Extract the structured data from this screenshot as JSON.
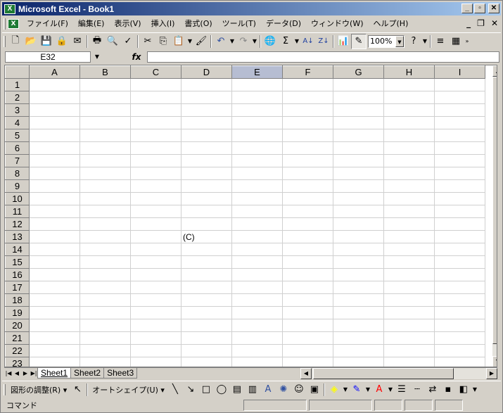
{
  "window": {
    "title": "Microsoft Excel - Book1",
    "app_icon": "X"
  },
  "menu": {
    "items": [
      "ファイル(F)",
      "編集(E)",
      "表示(V)",
      "挿入(I)",
      "書式(O)",
      "ツール(T)",
      "データ(D)",
      "ウィンドウ(W)",
      "ヘルプ(H)"
    ]
  },
  "toolbar": {
    "zoom": "100%"
  },
  "formula_bar": {
    "name_box": "E32",
    "fx": "fx",
    "content": ""
  },
  "grid": {
    "columns": [
      "A",
      "B",
      "C",
      "D",
      "E",
      "F",
      "G",
      "H",
      "I"
    ],
    "selected_column": "E",
    "rows": [
      "1",
      "2",
      "3",
      "4",
      "5",
      "6",
      "7",
      "8",
      "9",
      "10",
      "11",
      "12",
      "13",
      "14",
      "15",
      "16",
      "17",
      "18",
      "19",
      "20",
      "21",
      "22",
      "23"
    ],
    "cells": {
      "D13": "(C)"
    }
  },
  "sheets": {
    "tabs": [
      "Sheet1",
      "Sheet2",
      "Sheet3"
    ],
    "active": "Sheet1"
  },
  "drawing_toolbar": {
    "draw_label": "図形の調整(R)",
    "autoshape_label": "オートシェイプ(U)"
  },
  "status": {
    "text": "コマンド"
  },
  "colors": {
    "fill_color": "#ffff00",
    "line_color": "#0000ff",
    "font_color": "#ff0000",
    "accent": "#0a246a"
  }
}
